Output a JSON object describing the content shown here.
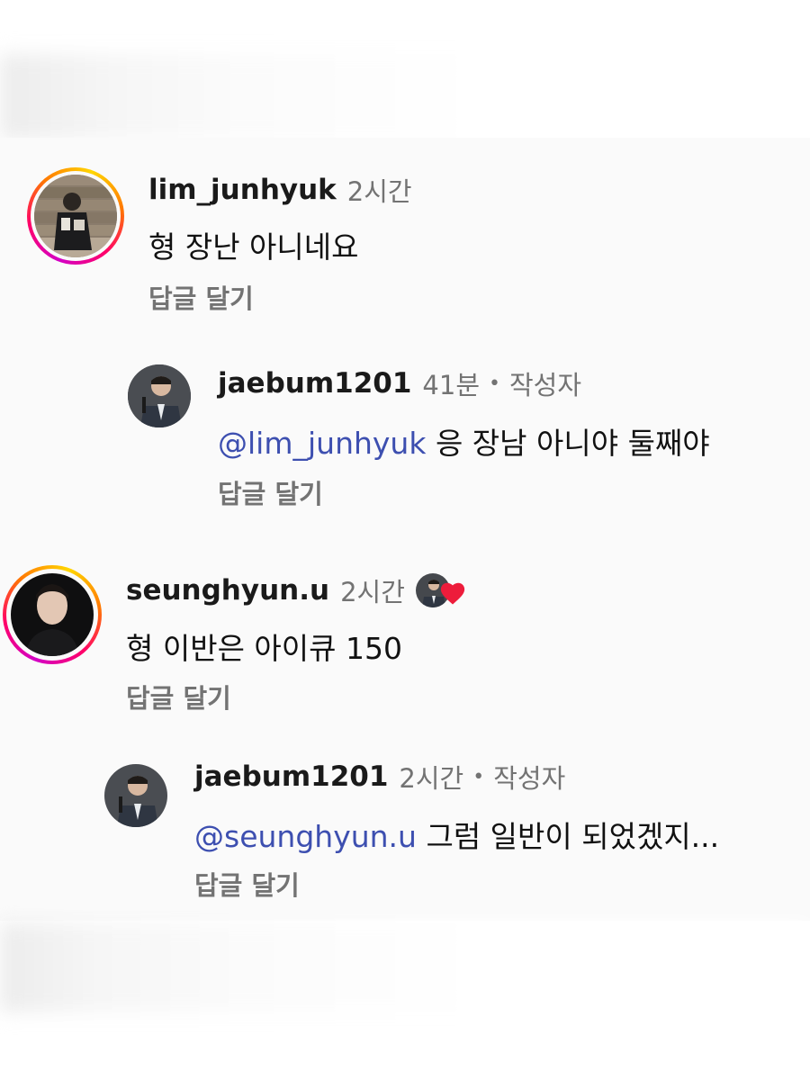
{
  "comments": [
    {
      "username": "lim_junhyuk",
      "time": "2시간",
      "text": "형 장난 아니네요",
      "reply_label": "답글 달기",
      "replies": [
        {
          "username": "jaebum1201",
          "time": "41분",
          "author_label": "작성자",
          "mention": "@lim_junhyuk",
          "text": "응 장남 아니야 둘째야",
          "reply_label": "답글 달기"
        }
      ]
    },
    {
      "username": "seunghyun.u",
      "time": "2시간",
      "text": "형 이반은 아이큐 150",
      "reply_label": "답글 달기",
      "liked_by_author": true,
      "replies": [
        {
          "username": "jaebum1201",
          "time": "2시간",
          "author_label": "작성자",
          "mention": "@seunghyun.u",
          "text": "그럼 일반이 되었겠지...",
          "reply_label": "답글 달기"
        }
      ]
    }
  ],
  "colors": {
    "mention": "#3d4fb0",
    "muted": "#737373",
    "heart": "#ed1c3b",
    "story_ring_start": "#d300c5",
    "story_ring_end": "#ffd600"
  },
  "icons": {
    "heart": "heart-icon",
    "story_ring": "story-ring"
  }
}
